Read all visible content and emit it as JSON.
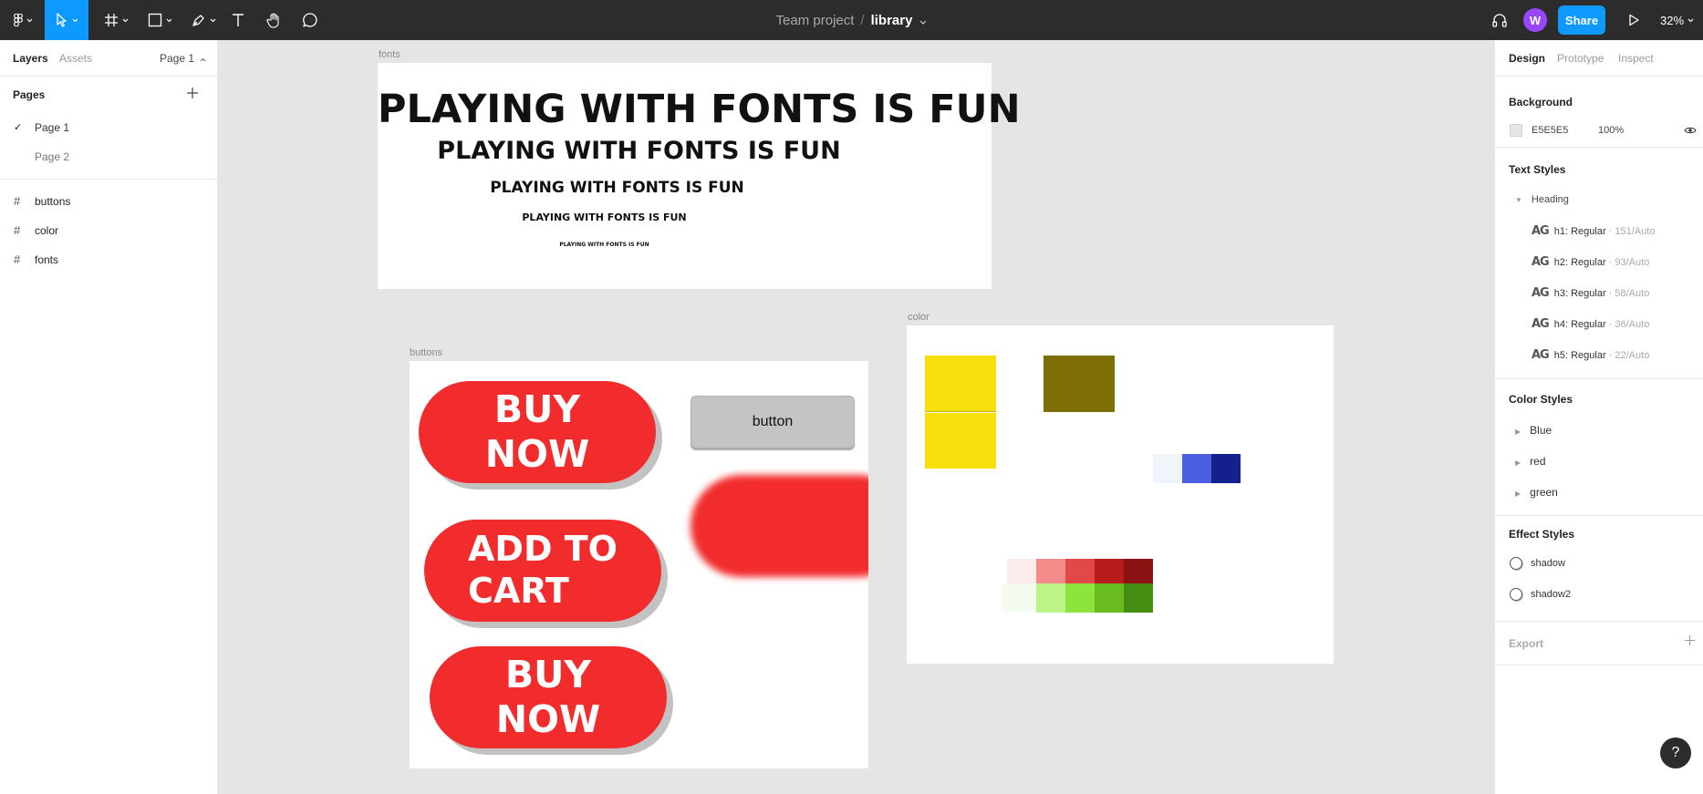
{
  "toolbar": {
    "doc_team": "Team project",
    "doc_separator": "/",
    "doc_file": "library",
    "avatar_initial": "W",
    "share_label": "Share",
    "zoom": "32%"
  },
  "left_panel": {
    "tabs": [
      "Layers",
      "Assets"
    ],
    "page_selector": "Page 1",
    "pages_label": "Pages",
    "pages": [
      "Page 1",
      "Page 2"
    ],
    "layers": [
      "buttons",
      "color",
      "fonts"
    ]
  },
  "canvas": {
    "frames": {
      "fonts": {
        "label": "fonts",
        "text": "PLAYING WITH FONTS IS FUN"
      },
      "buttons": {
        "label": "buttons",
        "buy_now_1": [
          "BUY",
          "NOW"
        ],
        "add_to_cart": [
          "ADD TO",
          "CART"
        ],
        "buy_now_2": [
          "BUY",
          "NOW"
        ],
        "plain_button": "button"
      },
      "color": {
        "label": "color"
      }
    },
    "colors": {
      "yellow": "#f7df0b",
      "olive": "#7d6e06",
      "blue_light": "#f2f4fc",
      "blue_mid": "#4a5fe0",
      "blue_dark": "#14208c",
      "red_scale": [
        "#fdecec",
        "#f48b8b",
        "#e24848",
        "#b91c1c",
        "#8a1212"
      ],
      "green_scale": [
        "#f4fcef",
        "#bdf48a",
        "#8ee43e",
        "#68bc1f",
        "#448c12"
      ],
      "button_red": "#f22c2c",
      "accent_blue": "#0d99ff"
    }
  },
  "right_panel": {
    "tabs": [
      "Design",
      "Prototype",
      "Inspect"
    ],
    "background": {
      "title": "Background",
      "hex": "E5E5E5",
      "opacity": "100%"
    },
    "text_styles": {
      "title": "Text Styles",
      "group": "Heading",
      "glyph": "AG",
      "items": [
        {
          "name": "h1: Regular",
          "meta": "· 151/Auto"
        },
        {
          "name": "h2: Regular",
          "meta": "· 93/Auto"
        },
        {
          "name": "h3: Regular",
          "meta": "· 58/Auto"
        },
        {
          "name": "h4: Regular",
          "meta": "· 36/Auto"
        },
        {
          "name": "h5: Regular",
          "meta": "· 22/Auto"
        }
      ]
    },
    "color_styles": {
      "title": "Color Styles",
      "items": [
        "Blue",
        "red",
        "green"
      ]
    },
    "effect_styles": {
      "title": "Effect Styles",
      "items": [
        "shadow",
        "shadow2"
      ]
    },
    "export_label": "Export"
  },
  "help_label": "?"
}
